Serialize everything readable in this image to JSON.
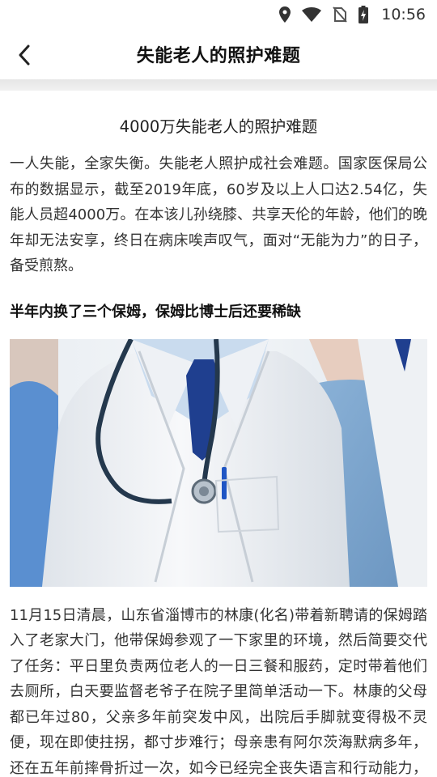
{
  "status_bar": {
    "time": "10:56",
    "icons": [
      "location-icon",
      "wifi-icon",
      "no-sim-icon",
      "battery-charging-icon"
    ]
  },
  "header": {
    "back_icon": "chevron-left-icon",
    "title": "失能老人的照护难题"
  },
  "article": {
    "title": "4000万失能老人的照护难题",
    "intro": "一人失能，全家失衡。失能老人照护成社会难题。国家医保局公布的数据显示，截至2019年底，60岁及以上人口达2.54亿，失能人员超4000万。在本该儿孙绕膝、共享天伦的年龄，他们的晚年却无法安享，终日在病床唉声叹气，面对“无能为力”的日子，备受煎熬。",
    "section_heading": "半年内换了三个保姆，保姆比博士后还要稀缺",
    "image": "doctor-with-stethoscope-photo",
    "body": "11月15日清晨，山东省淄博市的林康(化名)带着新聘请的保姆踏入了老家大门，他带保姆参观了一下家里的环境，然后简要交代了任务：平日里负责两位老人的一日三餐和服药，定时带着他们去厕所，白天要监督老爷子在院子里简单活动一下。林康的父母都已年过80，父亲多年前突发中风，出院后手脚就变得极不灵便，现在即使拄拐，都寸步难行；母亲患有阿尔茨海默病多年，还在五年前摔骨折过一次，如今已经完全丧失语言和行动能力，吃饭也只能吃"
  },
  "colors": {
    "coat_white": "#f3f5f8",
    "scrubs_blue": "#7fa8d0",
    "tie_blue": "#1f3f8f",
    "band_gray": "#ececec"
  }
}
